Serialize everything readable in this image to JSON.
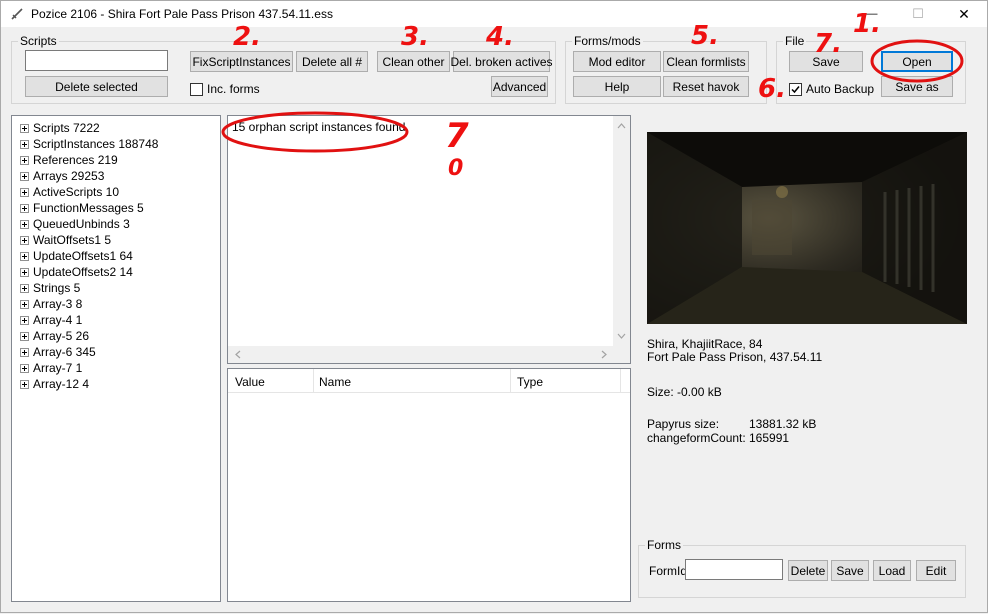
{
  "window": {
    "title": "Pozice 2106 - Shira  Fort Pale Pass Prison  437.54.11.ess",
    "minimize_glyph": "—",
    "maximize_glyph": "☐",
    "close_glyph": "✕"
  },
  "scripts_group": {
    "label": "Scripts",
    "search_value": "",
    "delete_selected": "Delete selected"
  },
  "toolbar": {
    "fix_script_instances": "FixScriptInstances",
    "delete_all_hash": "Delete all #",
    "inc_forms": "Inc. forms",
    "inc_forms_checked": false,
    "clean_other": "Clean other",
    "del_broken_actives": "Del. broken actives",
    "advanced": "Advanced"
  },
  "forms_mods_group": {
    "label": "Forms/mods",
    "mod_editor": "Mod editor",
    "clean_formlists": "Clean formlists",
    "help": "Help",
    "reset_havok": "Reset havok"
  },
  "file_group": {
    "label": "File",
    "save": "Save",
    "open": "Open",
    "auto_backup": "Auto Backup",
    "auto_backup_checked": true,
    "save_as": "Save as"
  },
  "tree": {
    "items": [
      "Scripts 7222",
      "ScriptInstances 188748",
      "References 219",
      "Arrays 29253",
      "ActiveScripts 10",
      "FunctionMessages 5",
      "QueuedUnbinds 3",
      "WaitOffsets1 5",
      "UpdateOffsets1 64",
      "UpdateOffsets2 14",
      "Strings 5",
      "Array-3 8",
      "Array-4 1",
      "Array-5 26",
      "Array-6 345",
      "Array-7 1",
      "Array-12 4"
    ]
  },
  "log": {
    "message": "15 orphan script instances found."
  },
  "table": {
    "columns": [
      "Value",
      "Name",
      "Type"
    ]
  },
  "info": {
    "character": "Shira, KhajiitRace, 84",
    "location": "Fort Pale Pass Prison, 437.54.11",
    "size_label": "Size: -0.00 kB",
    "papyrus_label": "Papyrus size:",
    "papyrus_value": "13881.32 kB",
    "changeform_label": "changeformCount:",
    "changeform_value": "165991"
  },
  "forms_group": {
    "label": "Forms",
    "formid_label": "FormId",
    "formid_value": "",
    "delete": "Delete",
    "save": "Save",
    "load": "Load",
    "edit": "Edit"
  },
  "annotations": {
    "n1": "1.",
    "n2": "2.",
    "n3": "3.",
    "n4": "4.",
    "n5": "5.",
    "n6": "6.",
    "n7": "7.",
    "n_log": "7",
    "n_log_sub": "0"
  },
  "colors": {
    "annotation": "#e11111",
    "window_bg": "#f0f0f0",
    "panel_bg": "#ffffff",
    "button_bg": "#e1e1e1",
    "accent_blue": "#0078d7"
  }
}
